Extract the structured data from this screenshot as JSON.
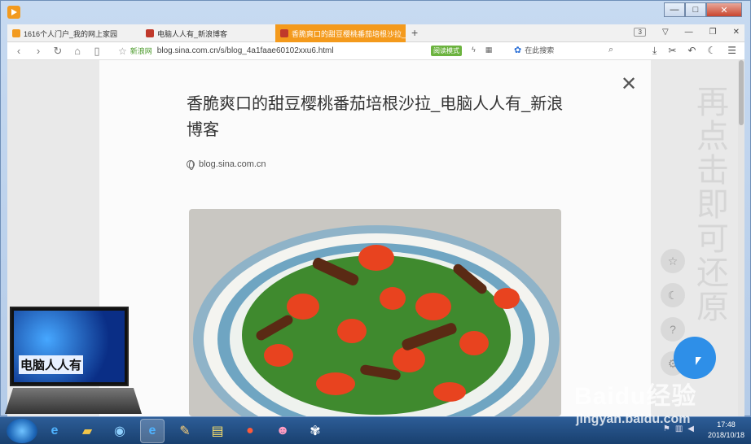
{
  "window": {
    "controls": {
      "minimize": "—",
      "maximize": "□",
      "close": "✕"
    }
  },
  "tabs": [
    {
      "label": "1616个人门户_我的网上家园",
      "favicon_color": "#f29a1f",
      "active": false
    },
    {
      "label": "电脑人人有_新浪博客",
      "favicon_color": "#c0392b",
      "active": false
    },
    {
      "label": "香脆爽口的甜豆樱桃番茄培根沙拉_电",
      "favicon_color": "#c0392b",
      "active": true
    }
  ],
  "tabstrip": {
    "add_label": "+",
    "tab_count": "3"
  },
  "address_bar": {
    "site_name": "新浪网",
    "url": "blog.sina.com.cn/s/blog_4a1faae60102xxu6.html",
    "read_mode_label": "阅读模式",
    "search_placeholder": "在此搜索"
  },
  "article": {
    "title": "香脆爽口的甜豆樱桃番茄培根沙拉_电脑人人有_新浪博客",
    "source": "blog.sina.com.cn"
  },
  "side_hint": "再点击即可还原",
  "watermarks": {
    "laptop_text": "电脑人人有",
    "baidu": "Baidu经验",
    "jingyan": "jingyan.baidu.com"
  },
  "taskbar": {
    "time": "17:48",
    "date": "2018/10/18"
  },
  "colors": {
    "active_tab": "#f49a1c",
    "read_mode": "#6cb33f",
    "fab": "#2e8fe8"
  }
}
